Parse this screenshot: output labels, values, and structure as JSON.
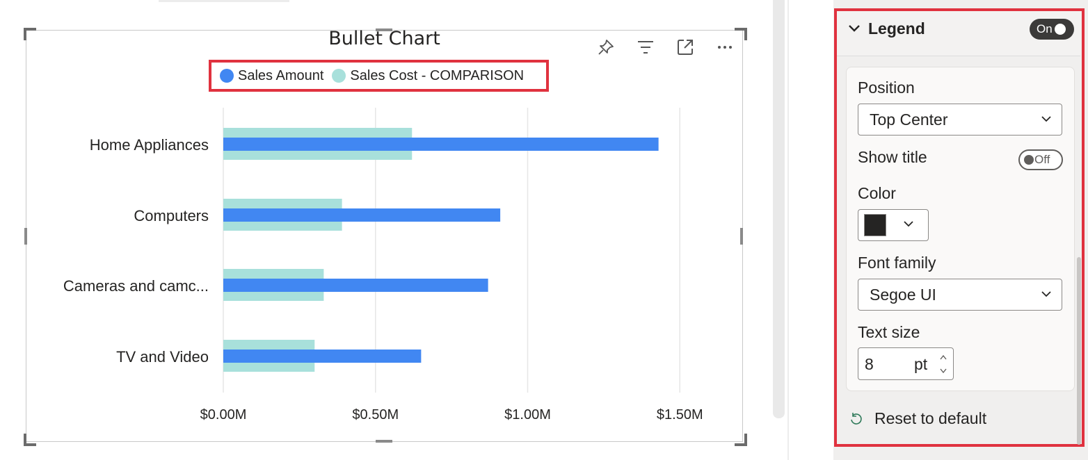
{
  "visual": {
    "title": "Bullet Chart",
    "header_icons": [
      "pin-icon",
      "filter-icon",
      "focus-mode-icon",
      "more-options-icon"
    ]
  },
  "chart_data": {
    "type": "bar",
    "orientation": "horizontal",
    "categories": [
      "Home Appliances",
      "Computers",
      "Cameras and camc...",
      "TV and Video"
    ],
    "series": [
      {
        "name": "Sales Cost - COMPARISON",
        "color": "#a8e0db",
        "values": [
          0.62,
          0.39,
          0.33,
          0.3
        ]
      },
      {
        "name": "Sales Amount",
        "color": "#4187f2",
        "values": [
          1.43,
          0.91,
          0.87,
          0.65
        ]
      }
    ],
    "x_ticks": [
      "$0.00M",
      "$0.50M",
      "$1.00M",
      "$1.50M"
    ],
    "xlim": [
      0,
      1.6
    ],
    "grid": true,
    "legend_position": "top-center"
  },
  "legend": {
    "items": [
      {
        "label": "Sales Amount",
        "color": "#4187f2"
      },
      {
        "label": "Sales Cost - COMPARISON",
        "color": "#a8e0db"
      }
    ]
  },
  "format_pane": {
    "section_title": "Legend",
    "section_toggle": "On",
    "position_label": "Position",
    "position_value": "Top Center",
    "show_title_label": "Show title",
    "show_title_toggle": "Off",
    "color_label": "Color",
    "color_value": "#252423",
    "font_family_label": "Font family",
    "font_family_value": "Segoe UI",
    "text_size_label": "Text size",
    "text_size_value": "8",
    "text_size_unit": "pt",
    "reset_label": "Reset to default"
  },
  "colors": {
    "highlight": "#e0323f"
  }
}
